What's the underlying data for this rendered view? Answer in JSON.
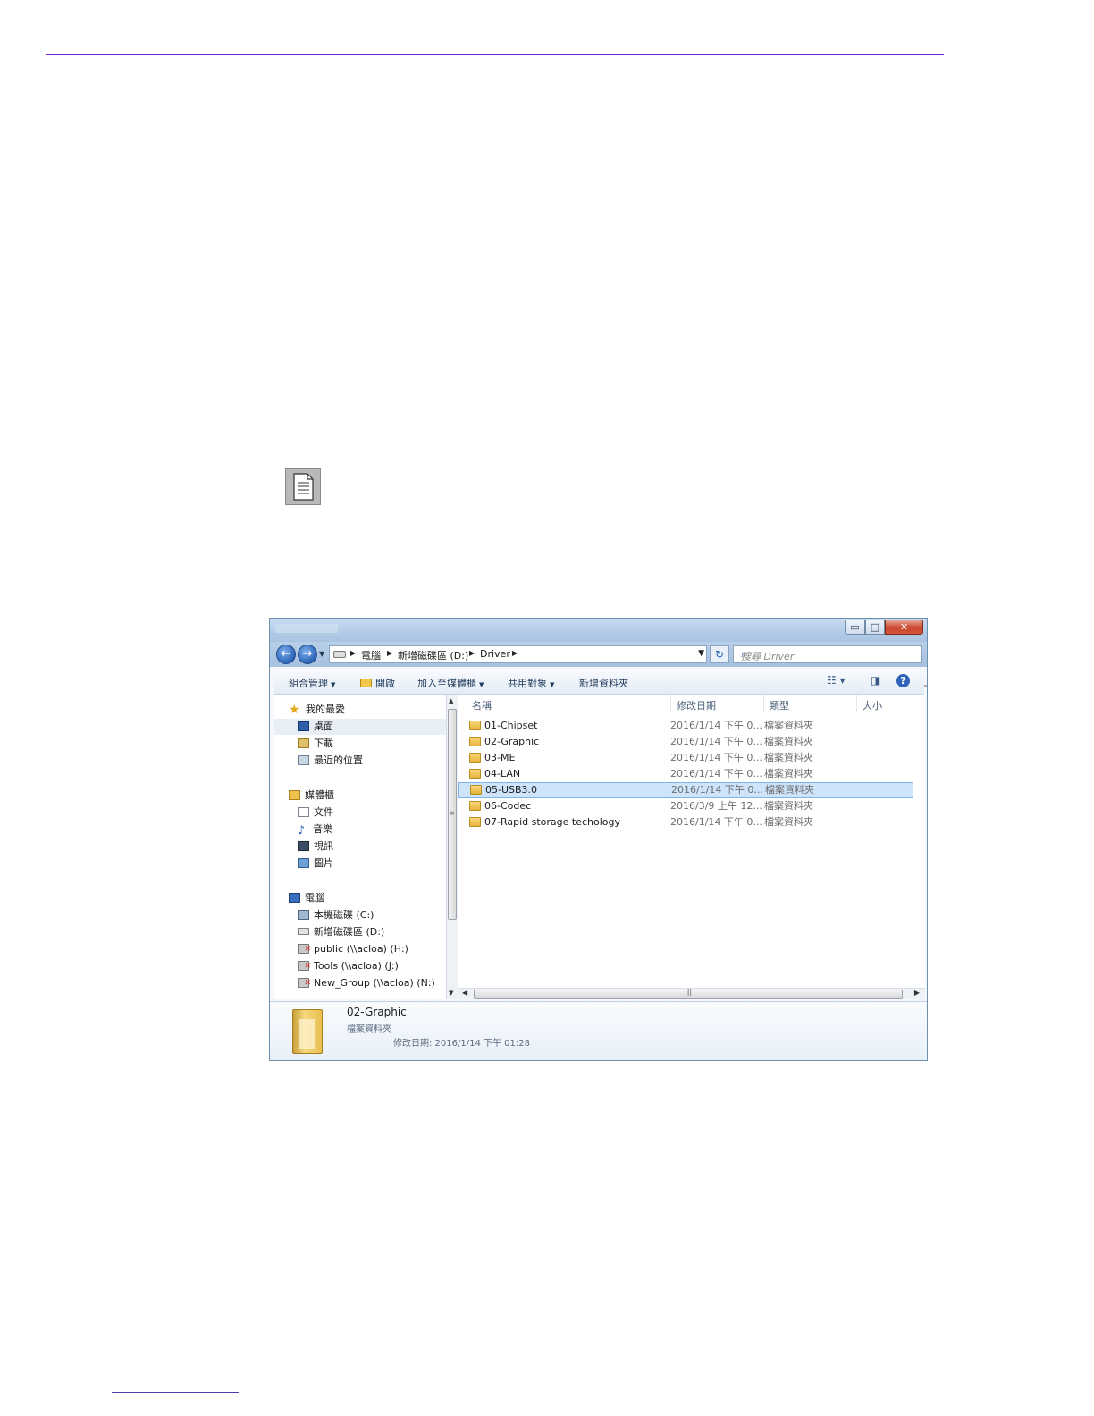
{
  "explorer": {
    "window_buttons": {
      "minimize": "▭",
      "maximize": "□",
      "close": "✕"
    },
    "breadcrumb": [
      "電腦",
      "新增磁碟區 (D:)",
      "Driver"
    ],
    "search_placeholder": "搜尋 Driver",
    "toolbar": {
      "organize": "組合管理",
      "open": "開啟",
      "add_to_library": "加入至媒體櫃",
      "share_with": "共用對象",
      "new_folder": "新增資料夾"
    },
    "nav_pane": {
      "favorites": {
        "label": "我的最愛",
        "items": [
          "桌面",
          "下載",
          "最近的位置"
        ]
      },
      "libraries": {
        "label": "媒體櫃",
        "items": [
          "文件",
          "音樂",
          "視訊",
          "圖片"
        ]
      },
      "computer": {
        "label": "電腦",
        "items": [
          "本機磁碟 (C:)",
          "新增磁碟區 (D:)",
          "public (\\\\acloa) (H:)",
          "Tools (\\\\acloa) (J:)",
          "New_Group (\\\\acloa) (N:)"
        ]
      }
    },
    "columns": {
      "name": "名稱",
      "modified": "修改日期",
      "type": "類型",
      "size": "大小"
    },
    "files": [
      {
        "name": "01-Chipset",
        "date": "2016/1/14 下午 0...",
        "type": "檔案資料夾"
      },
      {
        "name": "02-Graphic",
        "date": "2016/1/14 下午 0...",
        "type": "檔案資料夾"
      },
      {
        "name": "03-ME",
        "date": "2016/1/14 下午 0...",
        "type": "檔案資料夾"
      },
      {
        "name": "04-LAN",
        "date": "2016/1/14 下午 0...",
        "type": "檔案資料夾"
      },
      {
        "name": "05-USB3.0",
        "date": "2016/1/14 下午 0...",
        "type": "檔案資料夾"
      },
      {
        "name": "06-Codec",
        "date": "2016/3/9 上午 12...",
        "type": "檔案資料夾"
      },
      {
        "name": "07-Rapid storage techology",
        "date": "2016/1/14 下午 0...",
        "type": "檔案資料夾"
      }
    ],
    "selected_file": "05-USB3.0",
    "details": {
      "name": "02-Graphic",
      "type": "檔案資料夾",
      "modified": "修改日期: 2016/1/14 下午 01:28"
    }
  },
  "colors": {
    "accent_rule": "#7a1fd6",
    "selection": "#cde4fb"
  }
}
